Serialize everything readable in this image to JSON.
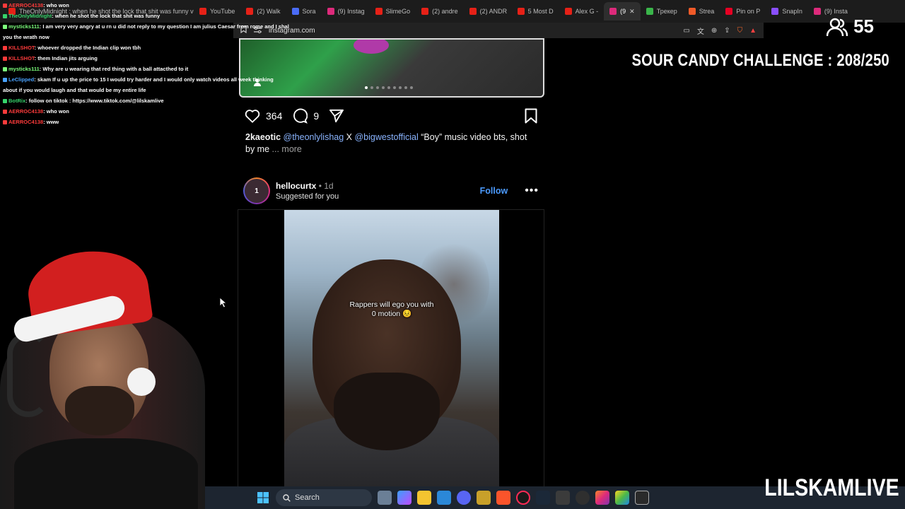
{
  "browser": {
    "tabs": [
      {
        "label": "TheOnlyMidnight : when he shot the lock that shit was funny video de",
        "color": "#e62117",
        "active": false
      },
      {
        "label": "YouTube",
        "color": "#e62117",
        "active": false
      },
      {
        "label": "(2) Walk",
        "color": "#e62117",
        "active": false
      },
      {
        "label": "Sora",
        "color": "#4a6cf7",
        "active": false
      },
      {
        "label": "(9) Instag",
        "color": "#dd2a7b",
        "active": false
      },
      {
        "label": "SlimeGo",
        "color": "#e62117",
        "active": false
      },
      {
        "label": "(2) andre",
        "color": "#e62117",
        "active": false
      },
      {
        "label": "(2) ANDR",
        "color": "#e62117",
        "active": false
      },
      {
        "label": "5 Most D",
        "color": "#e62117",
        "active": false
      },
      {
        "label": "Alex G -",
        "color": "#e62117",
        "active": false
      },
      {
        "label": "(9",
        "color": "#dd2a7b",
        "active": true
      },
      {
        "label": "Трекер",
        "color": "#3ab54a",
        "active": false
      },
      {
        "label": "Strea",
        "color": "#f05a28",
        "active": false
      },
      {
        "label": "Pin on P",
        "color": "#e60023",
        "active": false
      },
      {
        "label": "SnapIn",
        "color": "#8a4fff",
        "active": false
      },
      {
        "label": "(9) Insta",
        "color": "#dd2a7b",
        "active": false
      }
    ],
    "url": "instagram.com"
  },
  "chat": [
    {
      "user": "AERROC4138",
      "color": "#ff3b3b",
      "msg": ": who won"
    },
    {
      "user": "TheOnlyMidnight",
      "color": "#36d36b",
      "msg": ": when he shot the lock that shit was funny"
    },
    {
      "user": "mysticks111",
      "color": "#7cff7c",
      "msg": ": I am very very angry at u rn u did not reply to my question I am julius Caesar from rome and I shal give"
    },
    {
      "user": "",
      "color": "#ffffff",
      "msg": "you the wrath now"
    },
    {
      "user": "KILLSHOT",
      "color": "#ff3b3b",
      "msg": ": whoever dropped the Indian clip won tbh"
    },
    {
      "user": "KILLSHOT",
      "color": "#ff3b3b",
      "msg": ": them Indian jits arguing"
    },
    {
      "user": "mysticks111",
      "color": "#7cff7c",
      "msg": ": Why are u wearing that red thing with a ball attacthed to it"
    },
    {
      "user": "LeClipped",
      "color": "#4aa3ff",
      "msg": ": skam If u up the price to 15 I would try harder and I would only watch videos all week thinking"
    },
    {
      "user": "",
      "color": "#ffffff",
      "msg": "about if you would laugh and that would be my entire life"
    },
    {
      "user": "BotRix",
      "color": "#36d36b",
      "msg": ": follow on tiktok : https://www.tiktok.com/@lilskamlive"
    },
    {
      "user": "AERROC4138",
      "color": "#ff3b3b",
      "msg": ": who won"
    },
    {
      "user": "AERROC4138",
      "color": "#ff3b3b",
      "msg": ": www"
    }
  ],
  "overlay": {
    "viewer_count": "55",
    "challenge": "SOUR CANDY CHALLENGE : 208/250",
    "streamer": "LILSKAMLIVE"
  },
  "post1": {
    "likes": "364",
    "comments": "9",
    "caption_user": "2kaeotic",
    "mention1": "@theonlylishag",
    "caption_mid": " X ",
    "mention2": "@bigwestofficial",
    "caption_text": " “Boy” music video bts, shot by me ",
    "more": "... more",
    "carousel_dots": 9,
    "carousel_active": 0
  },
  "post2": {
    "username": "hellocurtx",
    "time": " • 1d",
    "subtitle": "Suggested for you",
    "follow": "Follow",
    "menu": "•••",
    "avatar_text": "1",
    "video_caption_line1": "Rappers will ego you with",
    "video_caption_line2": "0 motion 😣"
  },
  "taskbar": {
    "search": "Search"
  }
}
